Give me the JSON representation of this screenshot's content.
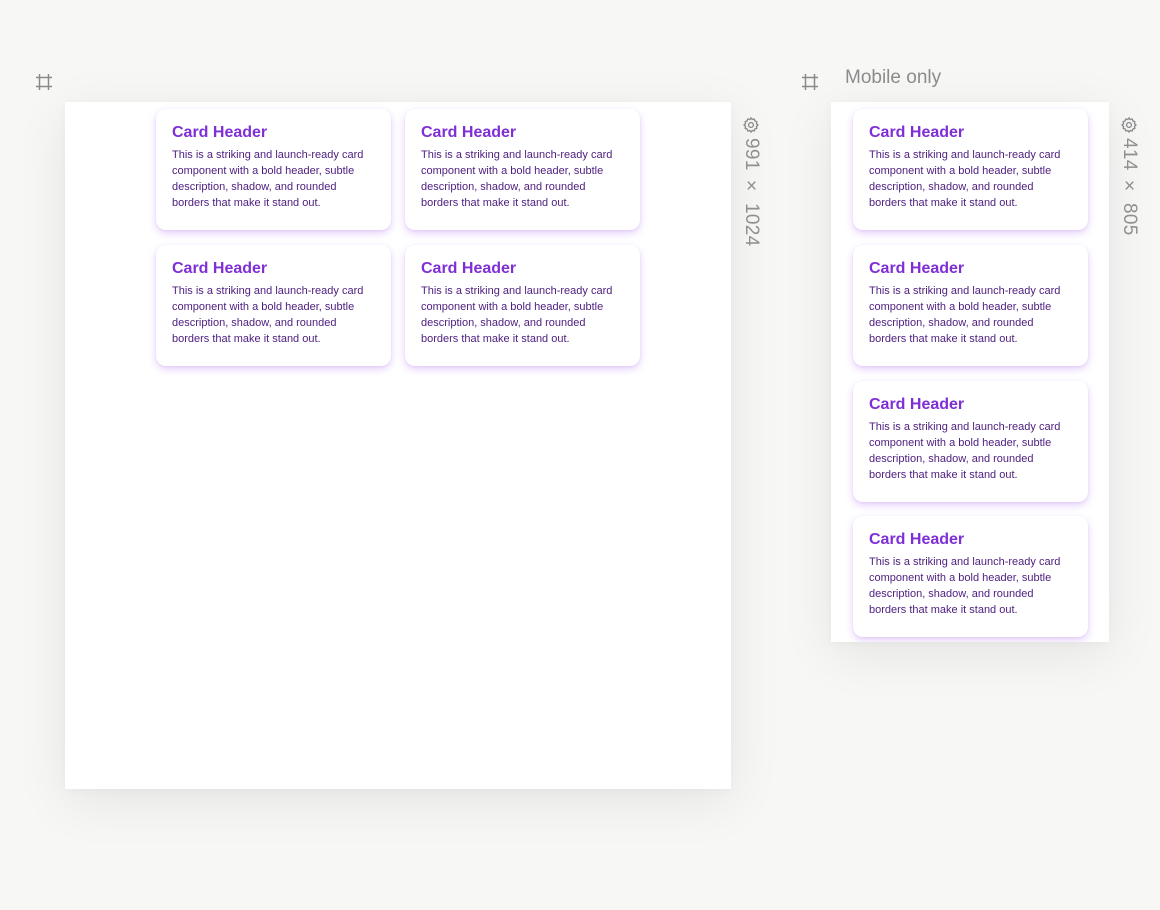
{
  "frames": [
    {
      "title": "",
      "size_label": "991 × 1024",
      "icons": {
        "frame": "frame-icon",
        "settings": "gear-icon"
      },
      "cards": [
        {
          "header": "Card Header",
          "description": "This is a striking and launch-ready card component with a bold header, subtle description, shadow, and rounded borders that make it stand out."
        },
        {
          "header": "Card Header",
          "description": "This is a striking and launch-ready card component with a bold header, subtle description, shadow, and rounded borders that make it stand out."
        },
        {
          "header": "Card Header",
          "description": "This is a striking and launch-ready card component with a bold header, subtle description, shadow, and rounded borders that make it stand out."
        },
        {
          "header": "Card Header",
          "description": "This is a striking and launch-ready card component with a bold header, subtle description, shadow, and rounded borders that make it stand out."
        }
      ]
    },
    {
      "title": "Mobile only",
      "size_label": "414 × 805",
      "icons": {
        "frame": "frame-icon",
        "settings": "gear-icon"
      },
      "cards": [
        {
          "header": "Card Header",
          "description": "This is a striking and launch-ready card component with a bold header, subtle description, shadow, and rounded borders that make it stand out."
        },
        {
          "header": "Card Header",
          "description": "This is a striking and launch-ready card component with a bold header, subtle description, shadow, and rounded borders that make it stand out."
        },
        {
          "header": "Card Header",
          "description": "This is a striking and launch-ready card component with a bold header, subtle description, shadow, and rounded borders that make it stand out."
        },
        {
          "header": "Card Header",
          "description": "This is a striking and launch-ready card component with a bold header, subtle description, shadow, and rounded borders that make it stand out."
        }
      ]
    }
  ],
  "colors": {
    "canvas_background": "#f7f7f6",
    "card_header": "#7e2fd6",
    "card_description": "#4c1d7e",
    "card_shadow": "#a855f7",
    "label_gray": "#8d8d8d"
  }
}
